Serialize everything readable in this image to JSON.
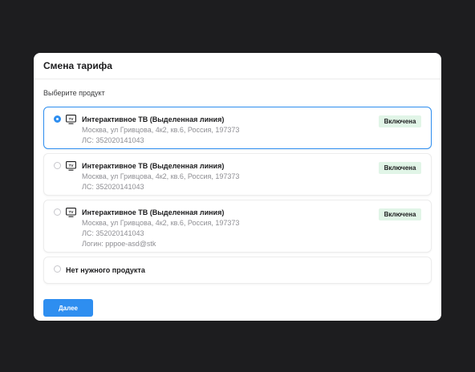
{
  "modal": {
    "title": "Смена тарифа",
    "subtitle": "Выберите продукт",
    "next_label": "Далее"
  },
  "products": [
    {
      "title": "Интерактивное ТВ (Выделенная линия)",
      "address": "Москва, ул Гривцова, 4к2, кв.6, Россия, 197373",
      "account": "ЛС: 352020141043",
      "status": "Включена",
      "selected": true,
      "icon": "tv-icon"
    },
    {
      "title": "Интерактивное ТВ (Выделенная линия)",
      "address": "Москва, ул Гривцова, 4к2, кв.6, Россия, 197373",
      "account": "ЛС: 352020141043",
      "status": "Включена",
      "selected": false,
      "icon": "tv-icon"
    },
    {
      "title": "Интерактивное ТВ (Выделенная линия)",
      "address": "Москва, ул Гривцова, 4к2, кв.6, Россия, 197373",
      "account": "ЛС: 352020141043",
      "login": "Логин: pppoe-asd@stk",
      "status": "Включена",
      "selected": false,
      "icon": "tv-icon"
    }
  ],
  "no_product": {
    "label": "Нет нужного продукта",
    "selected": false
  },
  "colors": {
    "accent": "#2e8ef0",
    "badge_bg": "#e1f5e7",
    "backdrop": "#1d1d1f"
  }
}
